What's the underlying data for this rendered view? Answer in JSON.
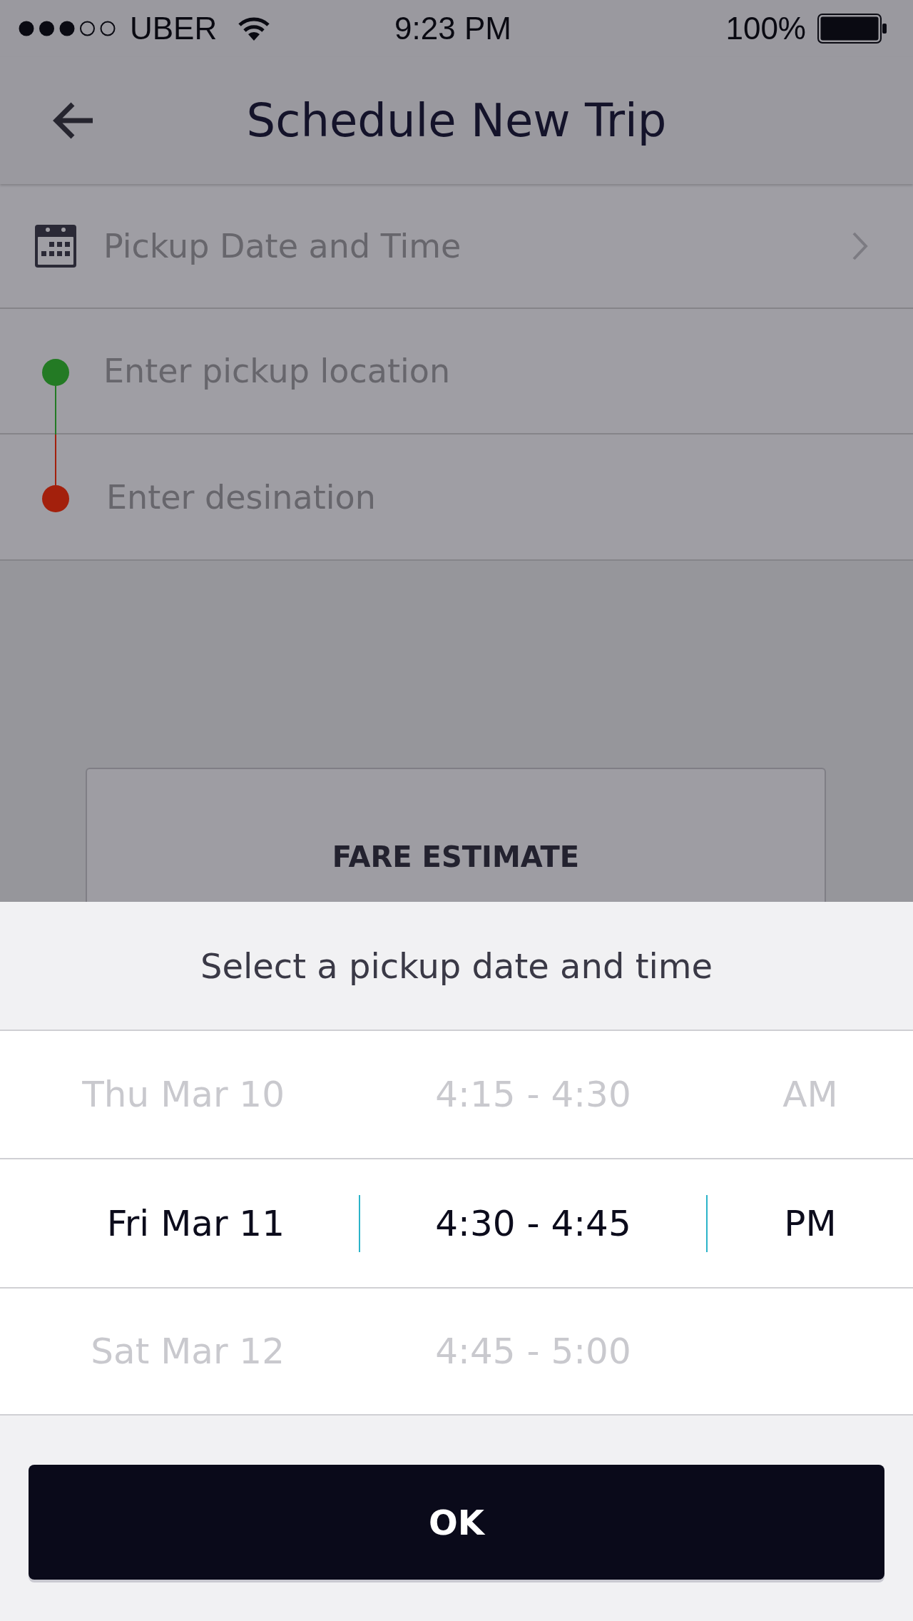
{
  "status_bar": {
    "carrier": "UBER",
    "time": "9:23 PM",
    "battery": "100%"
  },
  "header": {
    "title": "Schedule New Trip"
  },
  "form": {
    "date_time": {
      "label": "Pickup Date and Time"
    },
    "pickup": {
      "placeholder": "Enter pickup location"
    },
    "destination": {
      "placeholder": "Enter desination"
    }
  },
  "fare_estimate": {
    "label": "FARE ESTIMATE"
  },
  "picker": {
    "title": "Select a pickup date and time",
    "rows": [
      {
        "date": "Thu Mar 10",
        "time": "4:15 - 4:30",
        "period": "AM",
        "selected": false
      },
      {
        "date": "Fri Mar 11",
        "time": "4:30 - 4:45",
        "period": "PM",
        "selected": true
      },
      {
        "date": "Sat Mar 12",
        "time": "4:45 - 5:00",
        "selected": false
      }
    ]
  },
  "ok_button": {
    "label": "OK"
  }
}
